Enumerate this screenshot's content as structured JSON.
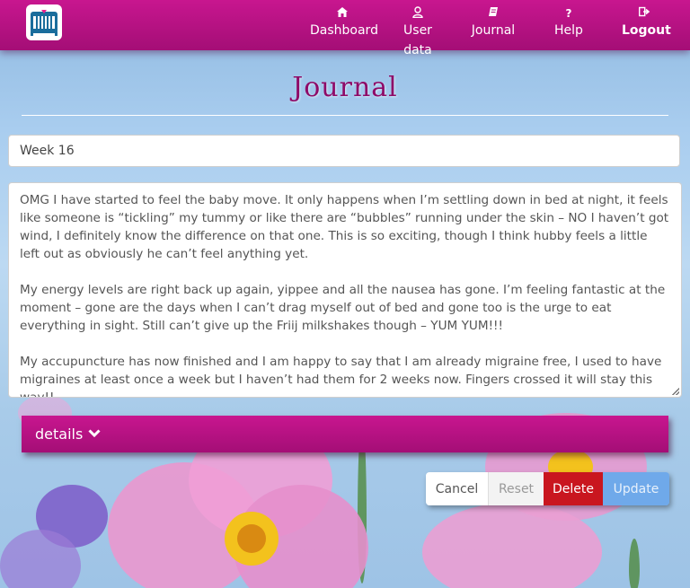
{
  "nav": {
    "items": [
      {
        "label": "Dashboard",
        "icon": "home-icon"
      },
      {
        "label": "User data",
        "icon": "user-icon"
      },
      {
        "label": "Journal",
        "icon": "book-icon"
      },
      {
        "label": "Help",
        "icon": "question-icon"
      },
      {
        "label": "Logout",
        "icon": "sign-out-icon"
      }
    ]
  },
  "page": {
    "title": "Journal"
  },
  "entry": {
    "title_value": "Week 16",
    "paragraphs": [
      "OMG I have started to feel the baby move.  It only happens when I’m settling down in bed at night, it feels like someone is “tickling” my tummy or like there are “bubbles” running under the skin – NO I haven’t got wind, I definitely know the difference on that one.  This is so exciting, though I think hubby feels a little left out as obviously he can’t feel anything yet.",
      "My energy levels are right back up again, yippee and all the nausea has gone.  I’m feeling fantastic at the moment – gone are the days when I can’t drag myself out of bed and gone too is the urge to eat everything in sight.  Still can’t give up the Friij milkshakes though – YUM YUM!!!",
      "My accupuncture has now finished and I am happy to say that I am already migraine free, I used to have migraines at least once a week but I haven’t had them for 2 weeks now.  Fingers crossed it will stay this way!!"
    ]
  },
  "details": {
    "label": "details"
  },
  "buttons": {
    "cancel": "Cancel",
    "reset": "Reset",
    "delete": "Delete",
    "update": "Update"
  },
  "colors": {
    "brand": "#b3127f",
    "title": "#8e0b68",
    "delete": "#c9161f",
    "update": "#6fa9ea"
  }
}
